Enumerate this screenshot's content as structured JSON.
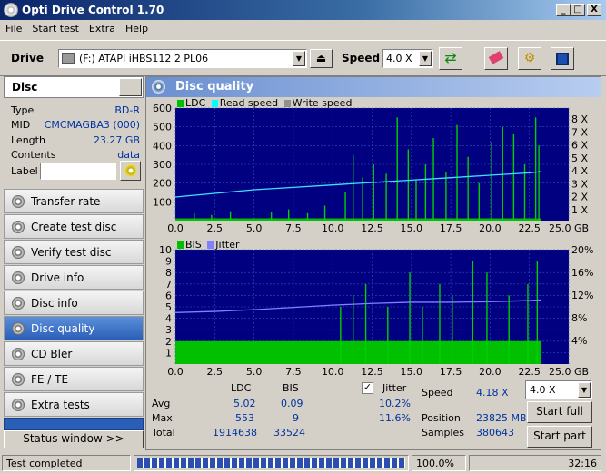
{
  "window": {
    "title": "Opti Drive Control 1.70",
    "min": "_",
    "max": "□",
    "close": "X"
  },
  "menu": [
    "File",
    "Start test",
    "Extra",
    "Help"
  ],
  "toolbar": {
    "drive_label": "Drive",
    "drive_value": "(F:)  ATAPI iHBS112  2 PL06",
    "speed_label": "Speed",
    "speed_value": "4.0 X"
  },
  "disc": {
    "header": "Disc",
    "rows": [
      {
        "k": "Type",
        "v": "BD-R"
      },
      {
        "k": "MID",
        "v": "CMCMAGBA3 (000)"
      },
      {
        "k": "Length",
        "v": "23.27 GB"
      },
      {
        "k": "Contents",
        "v": "data"
      }
    ],
    "label_label": "Label",
    "label_value": ""
  },
  "nav": [
    "Transfer rate",
    "Create test disc",
    "Verify test disc",
    "Drive info",
    "Disc info",
    "Disc quality",
    "CD Bler",
    "FE / TE",
    "Extra tests"
  ],
  "nav_selected": "Disc quality",
  "status_window": "Status window >>",
  "panel": {
    "title": "Disc quality"
  },
  "chart_data": [
    {
      "type": "bar",
      "title": "",
      "legend": [
        "LDC",
        "Read speed",
        "Write speed"
      ],
      "colors": {
        "LDC": "#00c000",
        "Read speed": "#00ffff",
        "Write speed": "#909090"
      },
      "x_ticks": [
        "0.0",
        "2.5",
        "5.0",
        "7.5",
        "10.0",
        "12.5",
        "15.0",
        "17.5",
        "20.0",
        "22.5",
        "25.0 GB"
      ],
      "y_ticks_left": [
        "600",
        "500",
        "400",
        "300",
        "200",
        "100"
      ],
      "y_ticks_right": [
        "8 X",
        "7 X",
        "6 X",
        "5 X",
        "4 X",
        "3 X",
        "2 X",
        "1 X"
      ],
      "xlim": [
        0,
        25
      ],
      "ylim": [
        0,
        600
      ],
      "read_speed_x": [
        0,
        2.5,
        5,
        7.5,
        10,
        12.5,
        15,
        17.5,
        20,
        22.5,
        23.27
      ],
      "read_speed_y": [
        1.8,
        2.1,
        2.4,
        2.6,
        2.8,
        3.0,
        3.2,
        3.4,
        3.6,
        3.8,
        3.9
      ],
      "ldc_spikes_x": [
        1.2,
        2.3,
        3.5,
        6.1,
        7.2,
        8.4,
        9.5,
        10.8,
        11.3,
        11.9,
        12.6,
        13.4,
        14.1,
        14.8,
        15.3,
        15.9,
        16.4,
        17.2,
        17.9,
        18.6,
        19.3,
        20.1,
        20.8,
        21.5,
        22.2,
        22.9,
        23.1
      ],
      "ldc_spikes_y": [
        40,
        30,
        50,
        45,
        60,
        40,
        80,
        150,
        350,
        230,
        300,
        250,
        550,
        380,
        220,
        300,
        440,
        260,
        510,
        340,
        200,
        420,
        500,
        460,
        300,
        550,
        400
      ],
      "ldc_base": 12
    },
    {
      "type": "bar",
      "title": "",
      "legend": [
        "BIS",
        "Jitter"
      ],
      "colors": {
        "BIS": "#00c000",
        "Jitter": "#8080ff"
      },
      "x_ticks": [
        "0.0",
        "2.5",
        "5.0",
        "7.5",
        "10.0",
        "12.5",
        "15.0",
        "17.5",
        "20.0",
        "22.5",
        "25.0 GB"
      ],
      "y_ticks_left": [
        "10",
        "9",
        "8",
        "7",
        "6",
        "5",
        "4",
        "3",
        "2",
        "1"
      ],
      "y_ticks_right": [
        "20%",
        "16%",
        "12%",
        "8%",
        "4%"
      ],
      "xlim": [
        0,
        25
      ],
      "ylim": [
        0,
        10
      ],
      "jitter_x": [
        0,
        2.5,
        5,
        7.5,
        10,
        12.5,
        15,
        17.5,
        20,
        22.5,
        23.27
      ],
      "jitter_y": [
        9.0,
        9.2,
        9.5,
        9.9,
        10.3,
        10.6,
        10.8,
        10.8,
        10.9,
        11.1,
        11.2
      ],
      "bis_spikes_x": [
        10.5,
        11.3,
        12.1,
        13.5,
        14.9,
        15.7,
        16.8,
        17.6,
        18.9,
        19.8,
        21.2,
        22.4,
        23.0
      ],
      "bis_spikes_y": [
        5,
        6,
        7,
        5,
        8,
        5,
        7,
        6,
        9,
        8,
        6,
        7,
        9
      ],
      "bis_base": 2
    }
  ],
  "stats": {
    "col_ldc": "LDC",
    "col_bis": "BIS",
    "rows": [
      {
        "k": "Avg",
        "ldc": "5.02",
        "bis": "0.09"
      },
      {
        "k": "Max",
        "ldc": "553",
        "bis": "9"
      },
      {
        "k": "Total",
        "ldc": "1914638",
        "bis": "33524"
      }
    ],
    "jitter_label": "Jitter",
    "jitter_avg": "10.2%",
    "jitter_max": "11.6%",
    "speed_label": "Speed",
    "speed_value": "4.18 X",
    "position_label": "Position",
    "position_value": "23825 MB",
    "samples_label": "Samples",
    "samples_value": "380643",
    "speed_select": "4.0 X",
    "start_full": "Start full",
    "start_part": "Start part"
  },
  "status": {
    "text": "Test completed",
    "progress": 1.0,
    "progress_text": "100.0%",
    "time": "32:16"
  }
}
